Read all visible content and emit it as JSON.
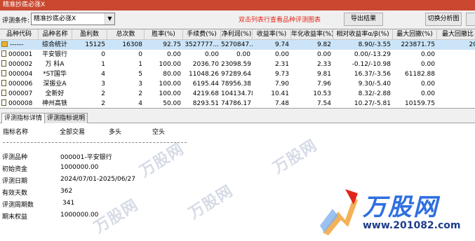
{
  "window": {
    "title": "精准抄底必涨X"
  },
  "toolbar": {
    "condition_label": "评测条件:",
    "condition_value": "精准抄底必涨X",
    "hint": "双击列表行查看品种评测图表",
    "export_label": "导出结果",
    "chart_label": "切换分析图"
  },
  "grid": {
    "headers": [
      "品种代码",
      "品种名称",
      "盈利数",
      "总次数",
      "胜率(%)",
      "手续费(%)",
      "净利润(%)",
      "收益率(%)",
      "年化收益率(%)",
      "相对收益率α/β(%)",
      "最大回撤(%)",
      "最大回撤比"
    ],
    "rows": [
      {
        "code": "------",
        "name": "综合统计",
        "win": "15125",
        "total": "16308",
        "rate": "92.75",
        "fee": "3527777...",
        "net": "5270847...",
        "ret": "9.74",
        "ann": "9.82",
        "rel": "8.90/-3.55",
        "dd": "223871.75",
        "ddr": "20"
      },
      {
        "code": "000001",
        "name": "平安银行",
        "win": "0",
        "total": "0",
        "rate": "0.00",
        "fee": "0.00",
        "net": "0.00",
        "ret": "0.00",
        "ann": "0.00",
        "rel": "0.00/-13.29",
        "dd": "0.00",
        "ddr": ""
      },
      {
        "code": "000002",
        "name": "万 科A",
        "win": "1",
        "total": "1",
        "rate": "100.00",
        "fee": "2036.70",
        "net": "23098.59",
        "ret": "2.31",
        "ann": "2.33",
        "rel": "-0.12/-10.98",
        "dd": "0.00",
        "ddr": ""
      },
      {
        "code": "000004",
        "name": "*ST国华",
        "win": "4",
        "total": "5",
        "rate": "80.00",
        "fee": "11048.26",
        "net": "97289.64",
        "ret": "9.73",
        "ann": "9.81",
        "rel": "16.37/-3.56",
        "dd": "61182.88",
        "ddr": ""
      },
      {
        "code": "000006",
        "name": "深振业A",
        "win": "3",
        "total": "3",
        "rate": "100.00",
        "fee": "6195.44",
        "net": "78956.38",
        "ret": "7.90",
        "ann": "7.96",
        "rel": "9.30/-5.40",
        "dd": "0.00",
        "ddr": ""
      },
      {
        "code": "000007",
        "name": "全新好",
        "win": "2",
        "total": "2",
        "rate": "100.00",
        "fee": "4219.68",
        "net": "104134.78",
        "ret": "10.41",
        "ann": "10.53",
        "rel": "8.32/-2.88",
        "dd": "0.00",
        "ddr": ""
      },
      {
        "code": "000008",
        "name": "神州高铁",
        "win": "2",
        "total": "4",
        "rate": "50.00",
        "fee": "8293.51",
        "net": "74786.17",
        "ret": "7.48",
        "ann": "7.54",
        "rel": "10.27/-5.81",
        "dd": "10159.75",
        "ddr": ""
      }
    ]
  },
  "tabs": {
    "detail": "评测指标详情",
    "explain": "评测指标说明"
  },
  "detail": {
    "col_metric": "指标名称",
    "col_all": "全部交易",
    "col_long": "多头",
    "col_short": "空头",
    "items": [
      {
        "label": "评测品种",
        "value": "000001-平安银行"
      },
      {
        "label": "初始资金",
        "value": "1000000.00"
      },
      {
        "label": "评测日期",
        "value": "2024/07/01-2025/06/27"
      },
      {
        "label": "有效天数",
        "value": "362"
      },
      {
        "label": "评测周期数",
        "value": "341"
      },
      {
        "label": "期末权益",
        "value": "1000000.00"
      }
    ]
  },
  "watermark": {
    "text": "万股网",
    "url": "www.201082.com"
  },
  "colors": {
    "title_bar": "#c9482f",
    "hint": "#e0261b",
    "selection": "#cce4f7",
    "logo_blue": "#2f6fe0"
  }
}
